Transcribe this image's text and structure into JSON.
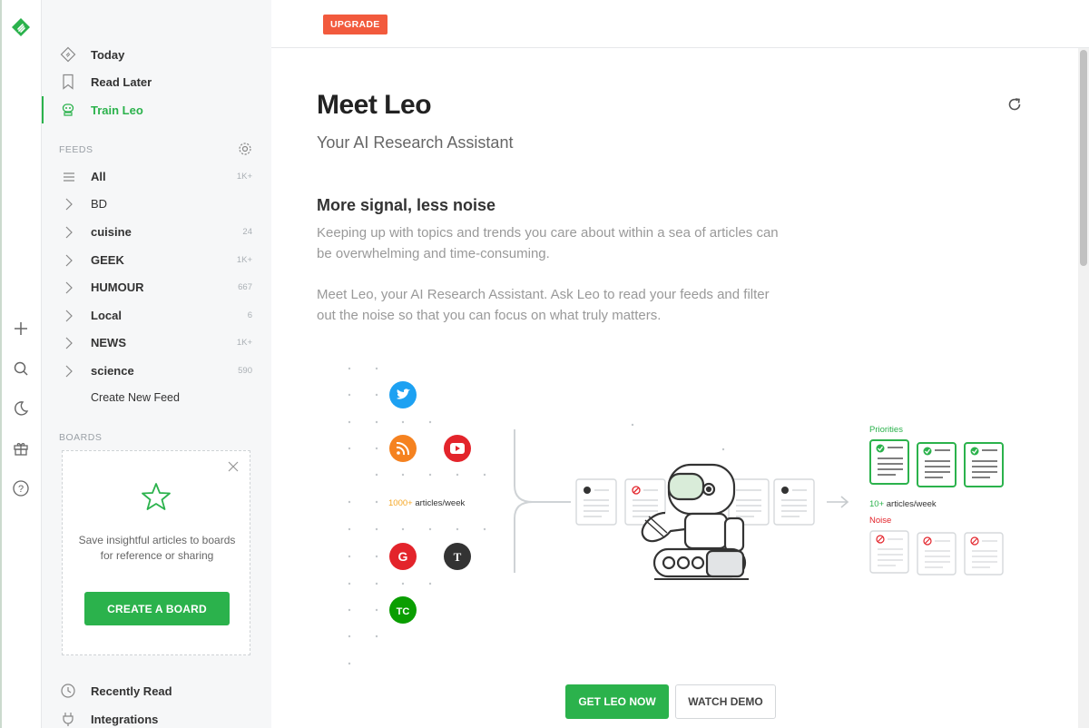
{
  "rail": {
    "icons": [
      "feedly-logo-icon",
      "plus-icon",
      "search-icon",
      "moon-icon",
      "gift-icon",
      "help-icon"
    ]
  },
  "sidebar": {
    "nav": [
      {
        "label": "Today",
        "icon": "today-icon"
      },
      {
        "label": "Read Later",
        "icon": "bookmark-icon"
      },
      {
        "label": "Train Leo",
        "icon": "leo-robot-icon",
        "active": true
      }
    ],
    "feeds_label": "FEEDS",
    "feeds": [
      {
        "label": "All",
        "count": "1K+"
      },
      {
        "label": "BD",
        "count": ""
      },
      {
        "label": "cuisine",
        "count": "24"
      },
      {
        "label": "GEEK",
        "count": "1K+"
      },
      {
        "label": "HUMOUR",
        "count": "667"
      },
      {
        "label": "Local",
        "count": "6"
      },
      {
        "label": "NEWS",
        "count": "1K+"
      },
      {
        "label": "science",
        "count": "590"
      }
    ],
    "create_feed": "Create New Feed",
    "boards_label": "BOARDS",
    "board_card": {
      "text": "Save insightful articles to boards for reference or sharing",
      "button": "CREATE A BOARD"
    },
    "bottom_nav": [
      {
        "label": "Recently Read",
        "icon": "clock-icon"
      },
      {
        "label": "Integrations",
        "icon": "plug-icon"
      }
    ]
  },
  "main": {
    "upgrade": "UPGRADE",
    "title": "Meet Leo",
    "subtitle": "Your AI Research Assistant",
    "section_title": "More signal, less noise",
    "para1": "Keeping up with topics and trends you care about within a sea of articles can be overwhelming and time-consuming.",
    "para2": "Meet Leo, your AI Research Assistant. Ask Leo to read your feeds and filter out the noise so that you can focus on what truly matters.",
    "illustration": {
      "input_count": "1000+",
      "input_unit": " articles/week",
      "priorities_label": "Priorities",
      "output_count": "10+",
      "output_unit": " articles/week",
      "noise_label": "Noise"
    },
    "cta_primary": "GET LEO NOW",
    "cta_secondary": "WATCH DEMO"
  },
  "colors": {
    "accent": "#2bb24c",
    "upgrade": "#f25a3d",
    "sidebar_bg": "#f6f7f8"
  }
}
